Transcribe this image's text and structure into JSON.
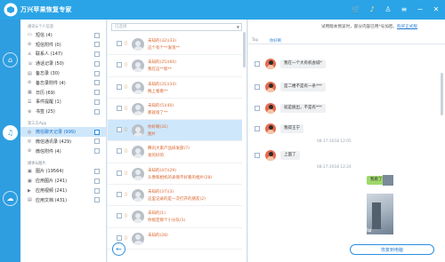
{
  "app": {
    "title": "万兴苹果恢复专家"
  },
  "window_controls": [
    "cart-icon",
    "bell-icon",
    "user-icon",
    "menu-icon",
    "minimize-icon",
    "close-icon"
  ],
  "notice": {
    "text": "试用版本预览时，部分内容已用*号加密。",
    "link": "购买正式版"
  },
  "sidebar": {
    "sections": [
      {
        "label": "通讯&个人信息",
        "items": [
          {
            "label": "短信 (4)",
            "icon": "sms-icon"
          },
          {
            "label": "短信附件 (0)",
            "icon": "attachment-icon"
          },
          {
            "label": "联系人 (147)",
            "icon": "contacts-icon"
          },
          {
            "label": "通话记录 (50)",
            "icon": "phone-icon"
          },
          {
            "label": "备忘录 (30)",
            "icon": "notes-icon"
          },
          {
            "label": "备忘录附件 (4)",
            "icon": "attachment-icon"
          },
          {
            "label": "日历 (69)",
            "icon": "calendar-icon"
          },
          {
            "label": "事件提醒 (1)",
            "icon": "reminder-icon"
          },
          {
            "label": "书签 (25)",
            "icon": "bookmark-icon"
          }
        ]
      },
      {
        "label": "第三方App",
        "items": [
          {
            "label": "微信聊天记录 (999)",
            "icon": "wechat-icon",
            "active": true
          },
          {
            "label": "微信通讯录 (429)",
            "icon": "wechat-icon"
          },
          {
            "label": "微信附件 (4)",
            "icon": "attachment-icon"
          }
        ]
      },
      {
        "label": "媒体&图片",
        "items": [
          {
            "label": "图片 (19564)",
            "icon": "photo-icon"
          },
          {
            "label": "应用图片 (241)",
            "icon": "photo-icon"
          },
          {
            "label": "应用视频 (241)",
            "icon": "video-icon"
          },
          {
            "label": "应用文档 (431)",
            "icon": "document-icon"
          }
        ]
      }
    ]
  },
  "message_list": {
    "search_placeholder": "已选择",
    "rows": [
      {
        "name": "未知的(32)(33)",
        "preview": "这个有个**发现**"
      },
      {
        "name": "未知的(25)(60)",
        "preview": "我在这**新**"
      },
      {
        "name": "未知的(31)(34)",
        "preview": "晚上看看**"
      },
      {
        "name": "未知的(5)(40)",
        "preview": "那就啥了**"
      },
      {
        "name": "你好啊(31)",
        "preview": "图片",
        "active": true
      },
      {
        "name": "腾讯大家产品研发部(7)",
        "preview": "发的好的"
      },
      {
        "name": "未知的(47)(29)",
        "preview": "头像和相机的表情不好看的相片(28)"
      },
      {
        "name": "未知的(37)(3)",
        "preview": "这里记录的是一次打开的朋友(2)"
      },
      {
        "name": "未知的(1)",
        "preview": "你搞定那个小分队(1)"
      },
      {
        "name": "未知的(28)",
        "preview": ""
      }
    ]
  },
  "chat": {
    "tabs": [
      "Top",
      "你好啊"
    ],
    "messages": [
      {
        "text": "我在一个大有机会城*"
      },
      {
        "text": "是二楼不是有一条***"
      },
      {
        "text": "就是脱出，不是有***"
      },
      {
        "text": "我得王宁"
      },
      {
        "text": "上面了"
      }
    ],
    "timestamps": [
      "08-17-2018 12:05",
      "08-27-2018 12:24"
    ],
    "self_message": "我看了"
  },
  "bottom": {
    "recover_label": "恢复到电脑",
    "watermark": "Baidu"
  }
}
